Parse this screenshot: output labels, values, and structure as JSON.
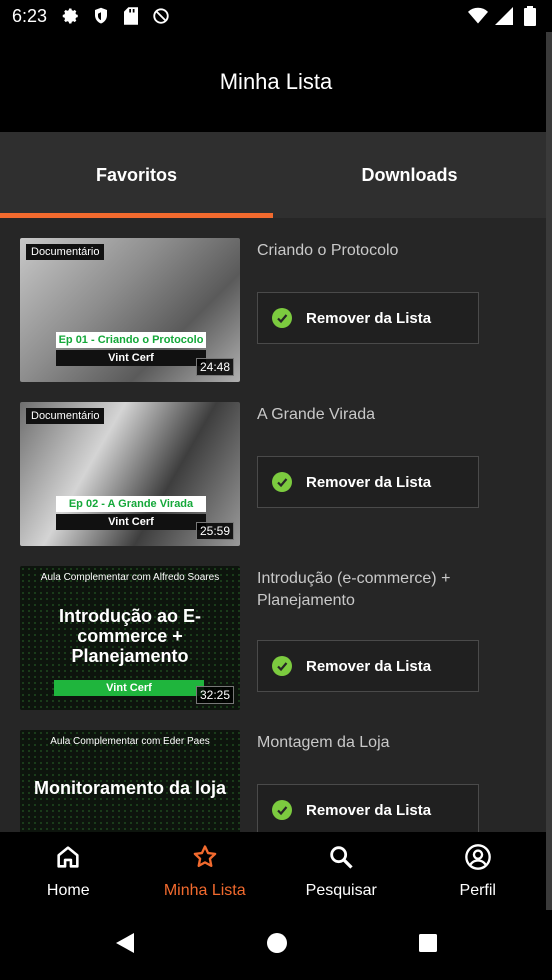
{
  "status": {
    "time": "6:23",
    "icons_left": [
      "gear-icon",
      "shield-icon",
      "sd-card-icon",
      "no-sim-icon"
    ],
    "icons_right": [
      "wifi-icon",
      "signal-icon",
      "battery-icon"
    ]
  },
  "header": {
    "title": "Minha Lista"
  },
  "tabs": [
    {
      "label": "Favoritos",
      "active": true
    },
    {
      "label": "Downloads",
      "active": false
    }
  ],
  "items": [
    {
      "title": "Criando o Protocolo",
      "thumb": {
        "badge": "Documentário",
        "episode": "Ep 01 - Criando o Protocolo",
        "author": "Vint Cerf",
        "duration": "24:48"
      },
      "button": "Remover da Lista"
    },
    {
      "title": "A Grande Virada",
      "thumb": {
        "badge": "Documentário",
        "episode": "Ep 02 - A Grande Virada",
        "author": "Vint Cerf",
        "duration": "25:59"
      },
      "button": "Remover da Lista"
    },
    {
      "title": "Introdução (e-commerce) + Planejamento",
      "thumb": {
        "top": "Aula Complementar com Alfredo Soares",
        "heading": "Introdução ao E-commerce + Planejamento",
        "author": "Vint Cerf",
        "duration": "32:25"
      },
      "button": "Remover da Lista"
    },
    {
      "title": "Montagem da Loja",
      "thumb": {
        "top": "Aula Complementar com Eder Paes",
        "heading": "Monitoramento da loja"
      },
      "button": "Remover da Lista"
    }
  ],
  "nav": [
    {
      "label": "Home",
      "icon": "home-icon",
      "active": false
    },
    {
      "label": "Minha Lista",
      "icon": "star-icon",
      "active": true
    },
    {
      "label": "Pesquisar",
      "icon": "search-icon",
      "active": false
    },
    {
      "label": "Perfil",
      "icon": "profile-icon",
      "active": false
    }
  ],
  "colors": {
    "accent": "#f26a2e",
    "check": "#7ccb3f",
    "background": "#262626"
  }
}
